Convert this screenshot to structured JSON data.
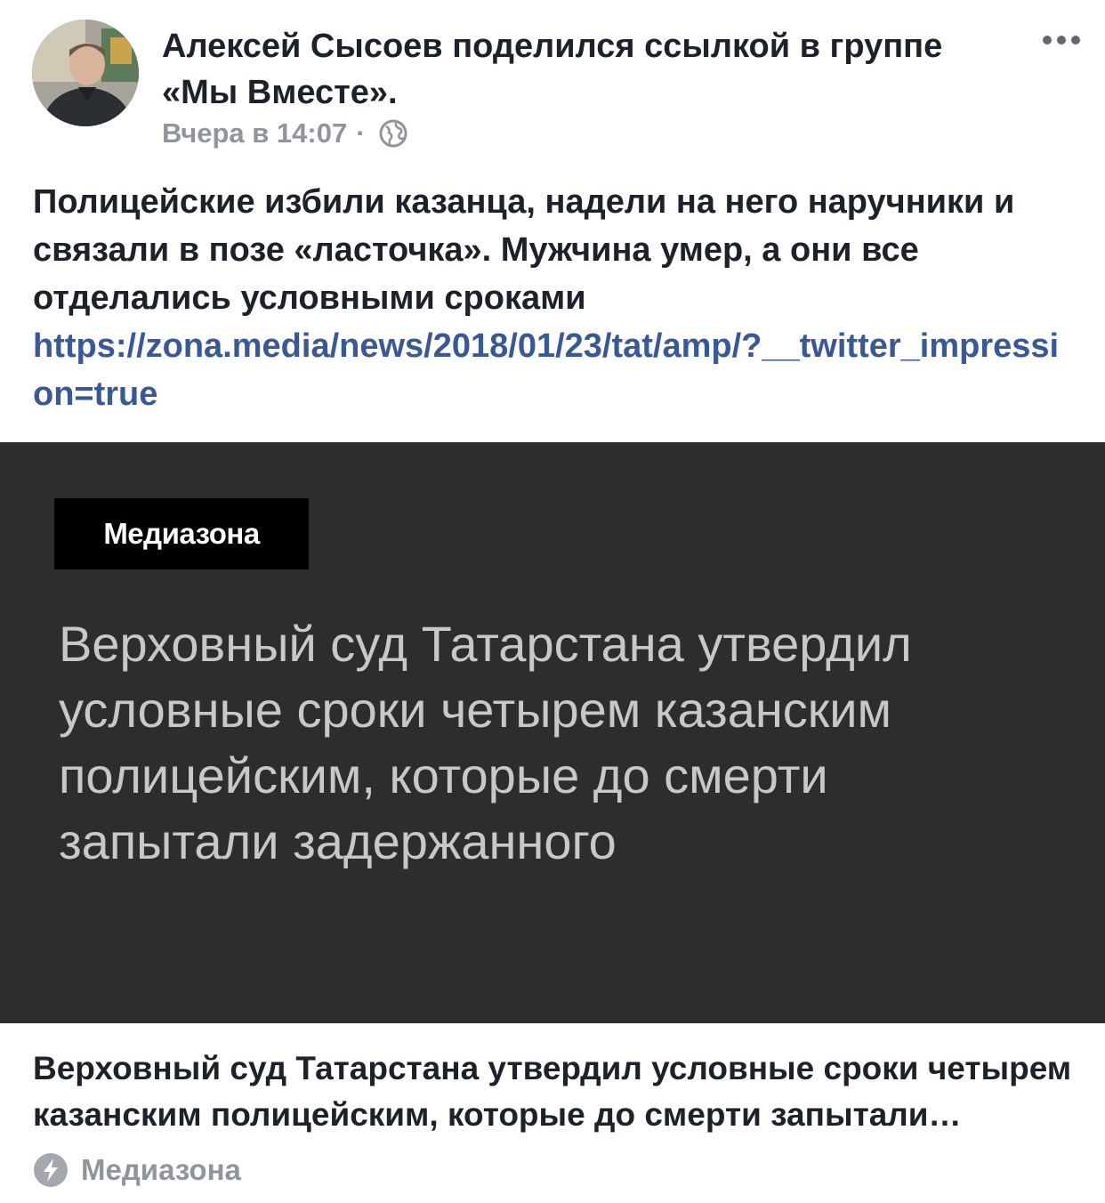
{
  "post": {
    "author": "Алексей Сысоев",
    "header_text": "Алексей Сысоев поделился ссылкой в группе «Мы Вместе».",
    "timestamp": "Вчера в 14:07",
    "separator": "·",
    "privacy_icon": "globe-icon",
    "body_text": "Полицейские избили казанца, надели на него наручники и связали в позе «ласточка». Мужчина умер, а они все отделались условными сроками",
    "link_url": "https://zona.media/news/2018/01/23/tat/amp/?__twitter_impression=true"
  },
  "preview": {
    "logo_text": "Медиазона",
    "headline": "Верховный суд Татарстана утвердил условные сроки четырем казанским полицейским, которые до смерти запытали задержанного"
  },
  "link_card": {
    "title": "Верховный суд Татарстана утвердил условные сроки четырем казанским полицейским, которые до смерти запытали задержанного",
    "source": "Медиазона",
    "source_icon": "lightning-bolt-icon"
  },
  "colors": {
    "text": "#1d2129",
    "meta": "#90949c",
    "link": "#385898",
    "preview_bg": "#2d2d2d"
  }
}
